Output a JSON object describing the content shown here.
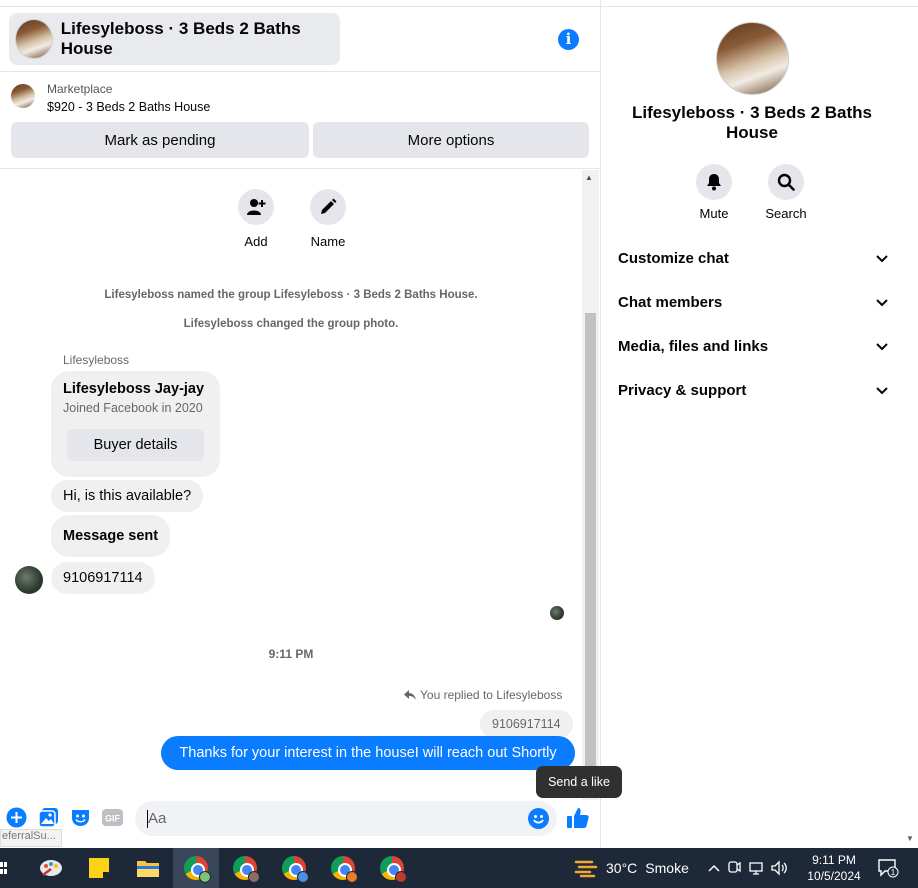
{
  "header": {
    "title": "Lifesyleboss · 3 Beds 2 Baths House"
  },
  "marketplace": {
    "label": "Marketplace",
    "listing": "$920 - 3 Beds 2 Baths House",
    "pending_label": "Mark as pending",
    "more_label": "More options"
  },
  "actions": {
    "add_label": "Add",
    "name_label": "Name"
  },
  "system_messages": [
    "Lifesyleboss named the group Lifesyleboss · 3 Beds 2 Baths House.",
    "Lifesyleboss changed the group photo."
  ],
  "conversation": {
    "sender": "Lifesyleboss",
    "card": {
      "name": "Lifesyleboss Jay-jay",
      "joined": "Joined Facebook in 2020",
      "button": "Buyer details"
    },
    "incoming": [
      "Hi, is this available?",
      "Message sent",
      "9106917114"
    ],
    "timestamp": "9:11 PM",
    "replied_label": "You replied to Lifesyleboss",
    "quoted": "9106917114",
    "outgoing": "Thanks for your interest in the houseI will reach out Shortly"
  },
  "tooltip": "Send a like",
  "composer": {
    "placeholder": "Aa",
    "referral_text": "eferralSu..."
  },
  "panel": {
    "title": "Lifesyleboss · 3 Beds 2 Baths House",
    "mute_label": "Mute",
    "search_label": "Search",
    "sections": [
      "Customize chat",
      "Chat members",
      "Media, files and links",
      "Privacy & support"
    ]
  },
  "taskbar": {
    "temperature": "30°C",
    "weather": "Smoke",
    "time": "9:11 PM",
    "date": "10/5/2024",
    "notifications": "1"
  },
  "colors": {
    "accent": "#0a7cff",
    "bubble_in": "#f0f0f0",
    "taskbar": "#1d2838"
  }
}
